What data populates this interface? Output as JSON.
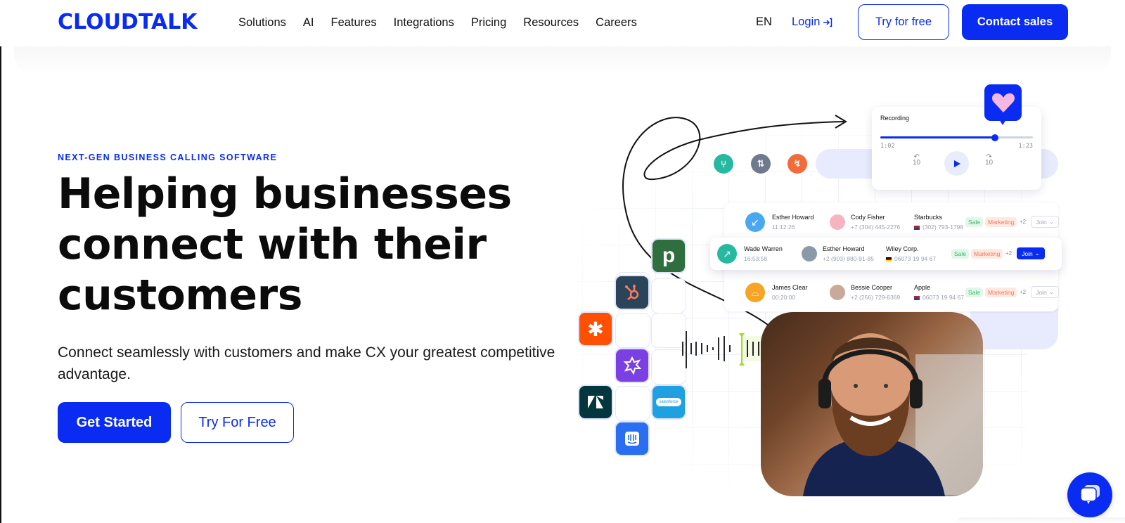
{
  "header": {
    "logo": "CLOUDTALK",
    "nav": [
      "Solutions",
      "AI",
      "Features",
      "Integrations",
      "Pricing",
      "Resources",
      "Careers"
    ],
    "language": "EN",
    "login": "Login",
    "try_free": "Try for free",
    "contact_sales": "Contact sales"
  },
  "hero": {
    "eyebrow": "NEXT-GEN BUSINESS CALLING SOFTWARE",
    "headline_line1": "Helping businesses",
    "headline_line2": "connect with their",
    "headline_line3": "customers",
    "subtext": "Connect seamlessly with customers and make CX your greatest competitive advantage.",
    "get_started": "Get Started",
    "try_for_free": "Try For Free"
  },
  "recording": {
    "title": "Recording",
    "current": "1:02",
    "total": "1:23",
    "progress_fraction": 0.75,
    "skip_back": "10",
    "skip_forward": "10"
  },
  "calls": [
    {
      "direction": "incoming",
      "dir_color": "#4aa8f0",
      "caller": "Esther Howard",
      "time": "11:12:26",
      "agent": "Cody Fisher",
      "agent_phone": "+7 (304) 445-2276",
      "company": "Starbucks",
      "company_phone": "(302) 793-1798",
      "flag": "us",
      "tags": [
        "Sale",
        "Marketing"
      ],
      "more": "+2",
      "join": "Join",
      "join_active": false
    },
    {
      "direction": "outgoing",
      "dir_color": "#27b9a0",
      "caller": "Wade Warren",
      "time": "16:53:58",
      "agent": "Esther Howard",
      "agent_phone": "+2 (903) 880-91-85",
      "company": "Wiley Corp.",
      "company_phone": "06073 19 94 67",
      "flag": "de",
      "tags": [
        "Sale",
        "Marketing"
      ],
      "more": "+2",
      "join": "Join",
      "join_active": true
    },
    {
      "direction": "voicemail",
      "dir_color": "#f7a325",
      "caller": "James Clear",
      "time": "00:20:00",
      "agent": "Bessie Cooper",
      "agent_phone": "+2 (256) 729-6369",
      "company": "Apple",
      "company_phone": "06073 19 94 67",
      "flag": "us",
      "tags": [
        "Sale",
        "Marketing"
      ],
      "more": "+2",
      "join": "Join",
      "join_active": false
    }
  ],
  "flow_icons": [
    {
      "name": "split-icon",
      "color": "#27b9a0"
    },
    {
      "name": "transfer-icon",
      "color": "#6f7a8c"
    },
    {
      "name": "trend-icon",
      "color": "#f26b3a"
    }
  ],
  "integrations": [
    {
      "name": "pipedrive",
      "label": "p",
      "color": "#2f6e3f"
    },
    {
      "name": "hubspot",
      "label": "",
      "color": "#2b4459"
    },
    {
      "name": "zapier",
      "label": "✱",
      "color": "#ff4f00"
    },
    {
      "name": "wrike",
      "label": "",
      "color": "#7b3fe4"
    },
    {
      "name": "zendesk",
      "label": "Z",
      "color": "#03363d"
    },
    {
      "name": "salesforce",
      "label": "salesforce",
      "color": "#1fa0e0"
    },
    {
      "name": "intercom",
      "label": "",
      "color": "#2a6ff2"
    }
  ],
  "colors": {
    "brand": "#0a2cf2",
    "lavender": "#e8ebfd",
    "accent_green": "#9be01f"
  }
}
